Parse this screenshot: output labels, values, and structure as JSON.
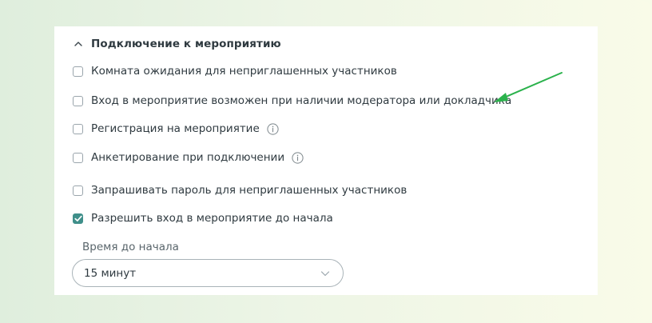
{
  "section": {
    "title": "Подключение к мероприятию",
    "expanded": true
  },
  "options": [
    {
      "label": "Комната ожидания для неприглашенных участников",
      "checked": false,
      "has_info": false
    },
    {
      "label": "Вход в мероприятие возможен при наличии модератора или докладчика",
      "checked": false,
      "has_info": false
    },
    {
      "label": "Регистрация на мероприятие",
      "checked": false,
      "has_info": true
    },
    {
      "label": "Анкетирование при подключении",
      "checked": false,
      "has_info": true
    },
    {
      "label": "Запрашивать пароль для неприглашенных участников",
      "checked": false,
      "has_info": false
    },
    {
      "label": "Разрешить вход в мероприятие до начала",
      "checked": true,
      "has_info": false
    }
  ],
  "start_time": {
    "label": "Время до начала",
    "value": "15 минут"
  },
  "colors": {
    "accent": "#3f8f8a",
    "annotation_arrow": "#2bb24c"
  },
  "icons": {
    "chevron": "chevron-up-icon",
    "info": "info-icon",
    "select": "chevron-down-icon",
    "arrow": "annotation-arrow"
  }
}
